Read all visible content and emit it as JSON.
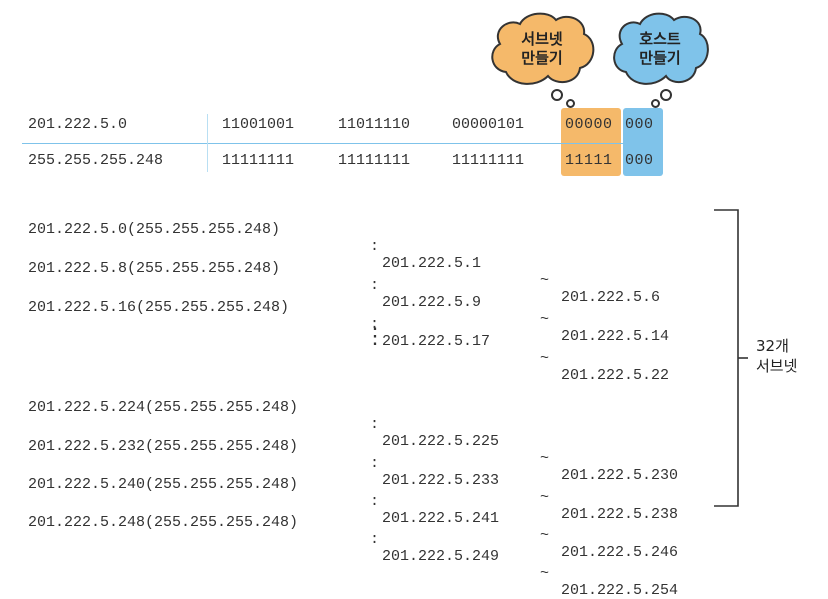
{
  "clouds": {
    "subnet_label": "서브넷\n만들기",
    "host_label": "호스트\n만들기",
    "subnet_color": "#f5b96a",
    "host_color": "#7fc3ea"
  },
  "table": {
    "ip_row": {
      "address": "201.222.5.0",
      "octets": [
        "11001001",
        "11011110",
        "00000101"
      ],
      "subnet_bits": "00000",
      "host_bits": "000"
    },
    "mask_row": {
      "address": "255.255.255.248",
      "octets": [
        "11111111",
        "11111111",
        "11111111"
      ],
      "subnet_bits": "11111",
      "host_bits": "000"
    }
  },
  "subnets_top": [
    {
      "network": "201.222.5.0(255.255.255.248)",
      "sep": ":",
      "first": "201.222.5.1",
      "tilde": "~",
      "last": "201.222.5.6"
    },
    {
      "network": "201.222.5.8(255.255.255.248)",
      "sep": ":",
      "first": "201.222.5.9",
      "tilde": "~",
      "last": "201.222.5.14"
    },
    {
      "network": "201.222.5.16(255.255.255.248)",
      "sep": ":",
      "first": "201.222.5.17",
      "tilde": "~",
      "last": "201.222.5.22"
    }
  ],
  "ellipsis": "⋮",
  "subnets_bottom": [
    {
      "network": "201.222.5.224(255.255.255.248)",
      "sep": ":",
      "first": "201.222.5.225",
      "tilde": "~",
      "last": "201.222.5.230"
    },
    {
      "network": "201.222.5.232(255.255.255.248)",
      "sep": ":",
      "first": "201.222.5.233",
      "tilde": "~",
      "last": "201.222.5.238"
    },
    {
      "network": "201.222.5.240(255.255.255.248)",
      "sep": ":",
      "first": "201.222.5.241",
      "tilde": "~",
      "last": "201.222.5.246"
    },
    {
      "network": "201.222.5.248(255.255.255.248)",
      "sep": ":",
      "first": "201.222.5.249",
      "tilde": "~",
      "last": "201.222.5.254"
    }
  ],
  "count_label": "32개\n서브넷"
}
